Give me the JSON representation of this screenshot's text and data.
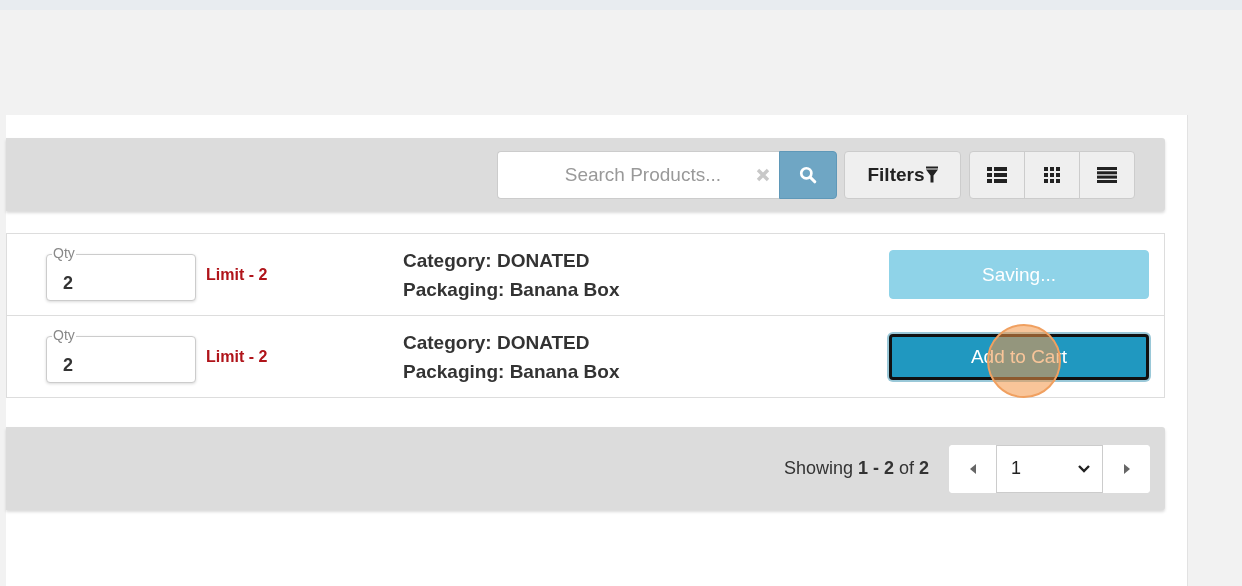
{
  "toolbar": {
    "search": {
      "placeholder": "Search Products..."
    },
    "filters_label": "Filters",
    "views": [
      {
        "kind": "list"
      },
      {
        "kind": "grid"
      },
      {
        "kind": "rows"
      }
    ]
  },
  "products": [
    {
      "qty_label": "Qty",
      "qty": "2",
      "limit": "Limit - 2",
      "category": "Category: DONATED",
      "packaging": "Packaging: Banana Box",
      "button": {
        "kind": "saving",
        "label": "Saving..."
      }
    },
    {
      "qty_label": "Qty",
      "qty": "2",
      "limit": "Limit - 2",
      "category": "Category: DONATED",
      "packaging": "Packaging: Banana Box",
      "button": {
        "kind": "add",
        "label": "Add to Cart"
      },
      "click_marker": true
    }
  ],
  "footer": {
    "showing": "Showing **1 - 2** of **2**",
    "page": "1"
  }
}
